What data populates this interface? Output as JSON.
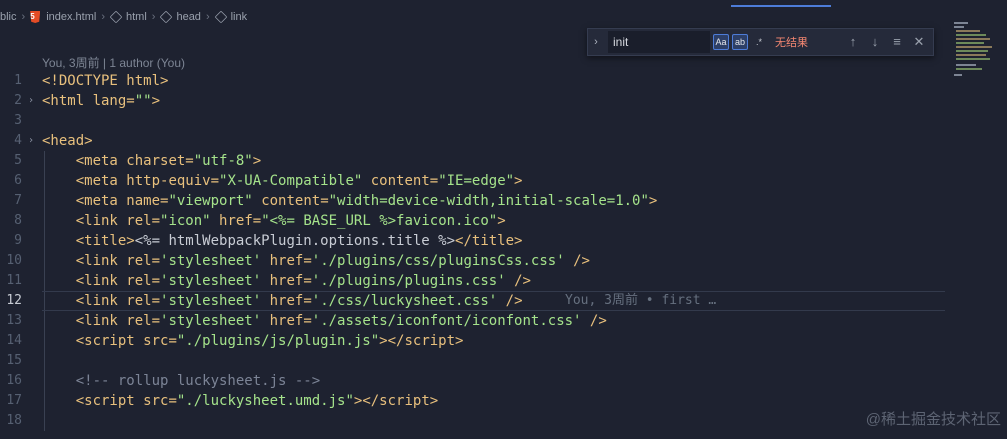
{
  "breadcrumb": {
    "items": [
      "blic",
      "index.html",
      "html",
      "head",
      "link"
    ]
  },
  "find_widget": {
    "query": "init",
    "match_case_label": "Aa",
    "whole_word_label": "ab",
    "regex_label": ".*",
    "result_text": "无结果"
  },
  "blame_header": "You, 3周前 | 1 author (You)",
  "inline_blame": "You, 3周前 • first …",
  "lines": [
    {
      "n": "1",
      "html": "<span class='t'>&lt;!DOCTYPE html&gt;</span>"
    },
    {
      "n": "2",
      "html": "<span class='t'>&lt;html </span><span class='a'>lang=</span><span class='s'>\"\"</span><span class='t'>&gt;</span>"
    },
    {
      "n": "3",
      "html": ""
    },
    {
      "n": "4",
      "html": "<span class='t'>&lt;head&gt;</span>"
    },
    {
      "n": "5",
      "html": "    <span class='t'>&lt;meta </span><span class='a'>charset=</span><span class='s'>\"utf-8\"</span><span class='t'>&gt;</span>"
    },
    {
      "n": "6",
      "html": "    <span class='t'>&lt;meta </span><span class='a'>http-equiv=</span><span class='s'>\"X-UA-Compatible\"</span> <span class='a'>content=</span><span class='s'>\"IE=edge\"</span><span class='t'>&gt;</span>"
    },
    {
      "n": "7",
      "html": "    <span class='t'>&lt;meta </span><span class='a'>name=</span><span class='s'>\"viewport\"</span> <span class='a'>content=</span><span class='s'>\"width=device-width,initial-scale=1.0\"</span><span class='t'>&gt;</span>"
    },
    {
      "n": "8",
      "html": "    <span class='t'>&lt;link </span><span class='a'>rel=</span><span class='s'>\"icon\"</span> <span class='a'>href=</span><span class='s'>\"&lt;%= BASE_URL %&gt;favicon.ico\"</span><span class='t'>&gt;</span>"
    },
    {
      "n": "9",
      "html": "    <span class='t'>&lt;title&gt;</span><span class='p'>&lt;%= htmlWebpackPlugin.options.title %&gt;</span><span class='t'>&lt;/title&gt;</span>"
    },
    {
      "n": "10",
      "html": "    <span class='t'>&lt;link </span><span class='a'>rel=</span><span class='s'>'stylesheet'</span> <span class='a'>href=</span><span class='s'>'./plugins/css/pluginsCss.css'</span> <span class='t'>/&gt;</span>"
    },
    {
      "n": "11",
      "html": "    <span class='t'>&lt;link </span><span class='a'>rel=</span><span class='s'>'stylesheet'</span> <span class='a'>href=</span><span class='s'>'./plugins/plugins.css'</span> <span class='t'>/&gt;</span>"
    },
    {
      "n": "12",
      "html": "    <span class='t'>&lt;link </span><span class='a'>rel=</span><span class='s'>'stylesheet'</span> <span class='a'>href=</span><span class='s'>'./css/luckysheet.css'</span> <span class='t'>/&gt;</span>"
    },
    {
      "n": "13",
      "html": "    <span class='t'>&lt;link </span><span class='a'>rel=</span><span class='s'>'stylesheet'</span> <span class='a'>href=</span><span class='s'>'./assets/iconfont/iconfont.css'</span> <span class='t'>/&gt;</span>"
    },
    {
      "n": "14",
      "html": "    <span class='t'>&lt;script </span><span class='a'>src=</span><span class='s'>\"./plugins/js/plugin.js\"</span><span class='t'>&gt;&lt;/script&gt;</span>"
    },
    {
      "n": "15",
      "html": ""
    },
    {
      "n": "16",
      "html": "    <span class='c'>&lt;!-- rollup luckysheet.js --&gt;</span>"
    },
    {
      "n": "17",
      "html": "    <span class='t'>&lt;script </span><span class='a'>src=</span><span class='s'>\"./luckysheet.umd.js\"</span><span class='t'>&gt;&lt;/script&gt;</span>"
    },
    {
      "n": "18",
      "html": ""
    }
  ],
  "watermark": "@稀土掘金技术社区",
  "colors": {
    "background": "#1e2230",
    "tag": "#e8c07d",
    "string": "#a5e38b",
    "accent": "#4d7cd8"
  }
}
